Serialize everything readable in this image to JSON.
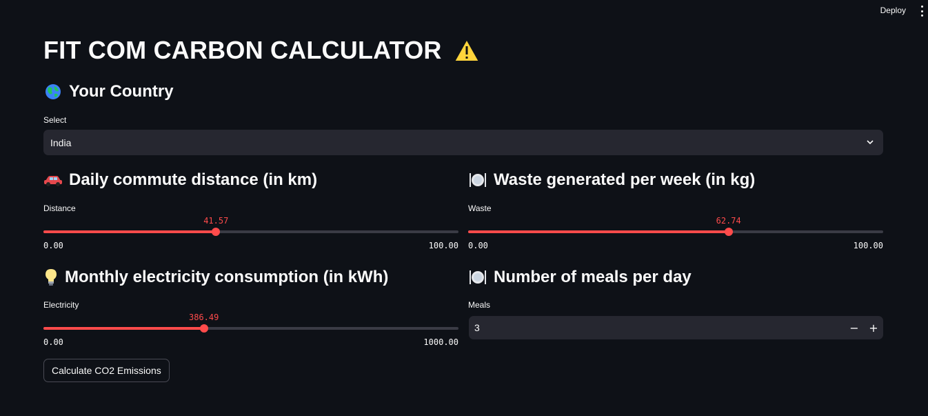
{
  "topbar": {
    "deploy_label": "Deploy"
  },
  "title": "FIT COM CARBON CALCULATOR",
  "country": {
    "heading": "Your Country",
    "label": "Select",
    "selected": "India"
  },
  "distance": {
    "heading": "Daily commute distance (in km)",
    "label": "Distance",
    "value": "41.57",
    "min": "0.00",
    "max": "100.00",
    "fraction": 0.4157
  },
  "waste": {
    "heading": "Waste generated per week (in kg)",
    "label": "Waste",
    "value": "62.74",
    "min": "0.00",
    "max": "100.00",
    "fraction": 0.6274
  },
  "electricity": {
    "heading": "Monthly electricity consumption (in kWh)",
    "label": "Electricity",
    "value": "386.49",
    "min": "0.00",
    "max": "1000.00",
    "fraction": 0.38649
  },
  "meals": {
    "heading": "Number of meals per day",
    "label": "Meals",
    "value": "3",
    "minus": "−",
    "plus": "+"
  },
  "button_label": "Calculate CO2 Emissions",
  "colors": {
    "accent": "#ff4b4b",
    "background": "#0e1117",
    "input_bg": "#262730"
  },
  "icons": {
    "title": "warning-icon",
    "country": "globe-icon",
    "distance": "car-icon",
    "waste": "plate-icon",
    "electricity": "lightbulb-icon",
    "meals": "plate-icon"
  }
}
